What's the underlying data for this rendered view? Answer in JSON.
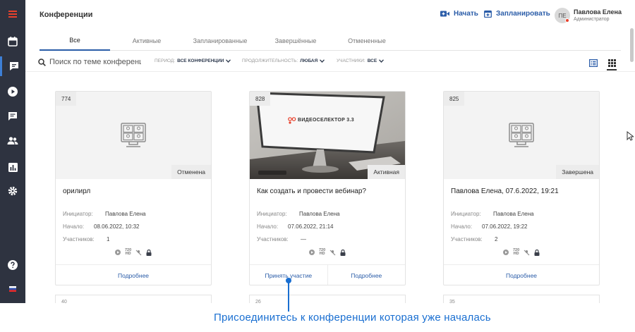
{
  "sidebar": {
    "items": [
      {
        "icon": "hamburger-menu-icon"
      },
      {
        "icon": "calendar-icon"
      },
      {
        "icon": "conference-icon",
        "active": true
      },
      {
        "icon": "play-icon"
      },
      {
        "icon": "chat-icon"
      },
      {
        "icon": "users-icon"
      },
      {
        "icon": "statistics-icon"
      },
      {
        "icon": "gear-icon"
      },
      {
        "icon": "help-icon"
      },
      {
        "icon": "language-flag-icon"
      }
    ]
  },
  "header": {
    "title": "Конференции",
    "start_label": "Начать",
    "schedule_label": "Запланировать",
    "user": {
      "initials": "ПЕ",
      "name": "Павлова Елена",
      "role": "Администратор"
    }
  },
  "tabs": [
    {
      "label": "Все",
      "active": true
    },
    {
      "label": "Активные"
    },
    {
      "label": "Запланированные"
    },
    {
      "label": "Завершённые"
    },
    {
      "label": "Отмененные"
    }
  ],
  "filters": {
    "search_placeholder": "Поиск по теме конференции",
    "period": {
      "label": "ПЕРИОД:",
      "value": "ВСЕ КОНФЕРЕНЦИИ"
    },
    "duration": {
      "label": "ПРОДОЛЖИТЕЛЬНОСТЬ:",
      "value": "ЛЮБАЯ"
    },
    "participants": {
      "label": "УЧАСТНИКИ:",
      "value": "ВСЕ"
    }
  },
  "card_labels": {
    "initiator": "Инициатор:",
    "start": "Начало:",
    "participants": "Участников:",
    "details": "Подробнее",
    "join": "Принять участие"
  },
  "cards": [
    {
      "id": "774",
      "status": "Отменена",
      "title": "орилирл",
      "initiator": "Павлова Елена",
      "start": "08.06.2022, 10:32",
      "participants": "1"
    },
    {
      "id": "828",
      "status": "Активная",
      "title": "Как создать и провести вебинар?",
      "initiator": "Павлова Елена",
      "start": "07.06.2022, 21:14",
      "participants": "—",
      "brand": "ВИДЕОСЕЛЕКТОР 3.3"
    },
    {
      "id": "825",
      "status": "Завершена",
      "title": "Павлова Елена, 07.6.2022, 19:21",
      "initiator": "Павлова Елена",
      "start": "07.06.2022, 19:22",
      "participants": "2"
    }
  ],
  "next_row_ids": [
    "40",
    "26",
    "35"
  ],
  "annotation": "Присоединитесь к конференции которая уже началась",
  "colors": {
    "sidebar": "#2e3340",
    "accent": "#2a5ca8",
    "annotation": "#1a6fd1"
  }
}
